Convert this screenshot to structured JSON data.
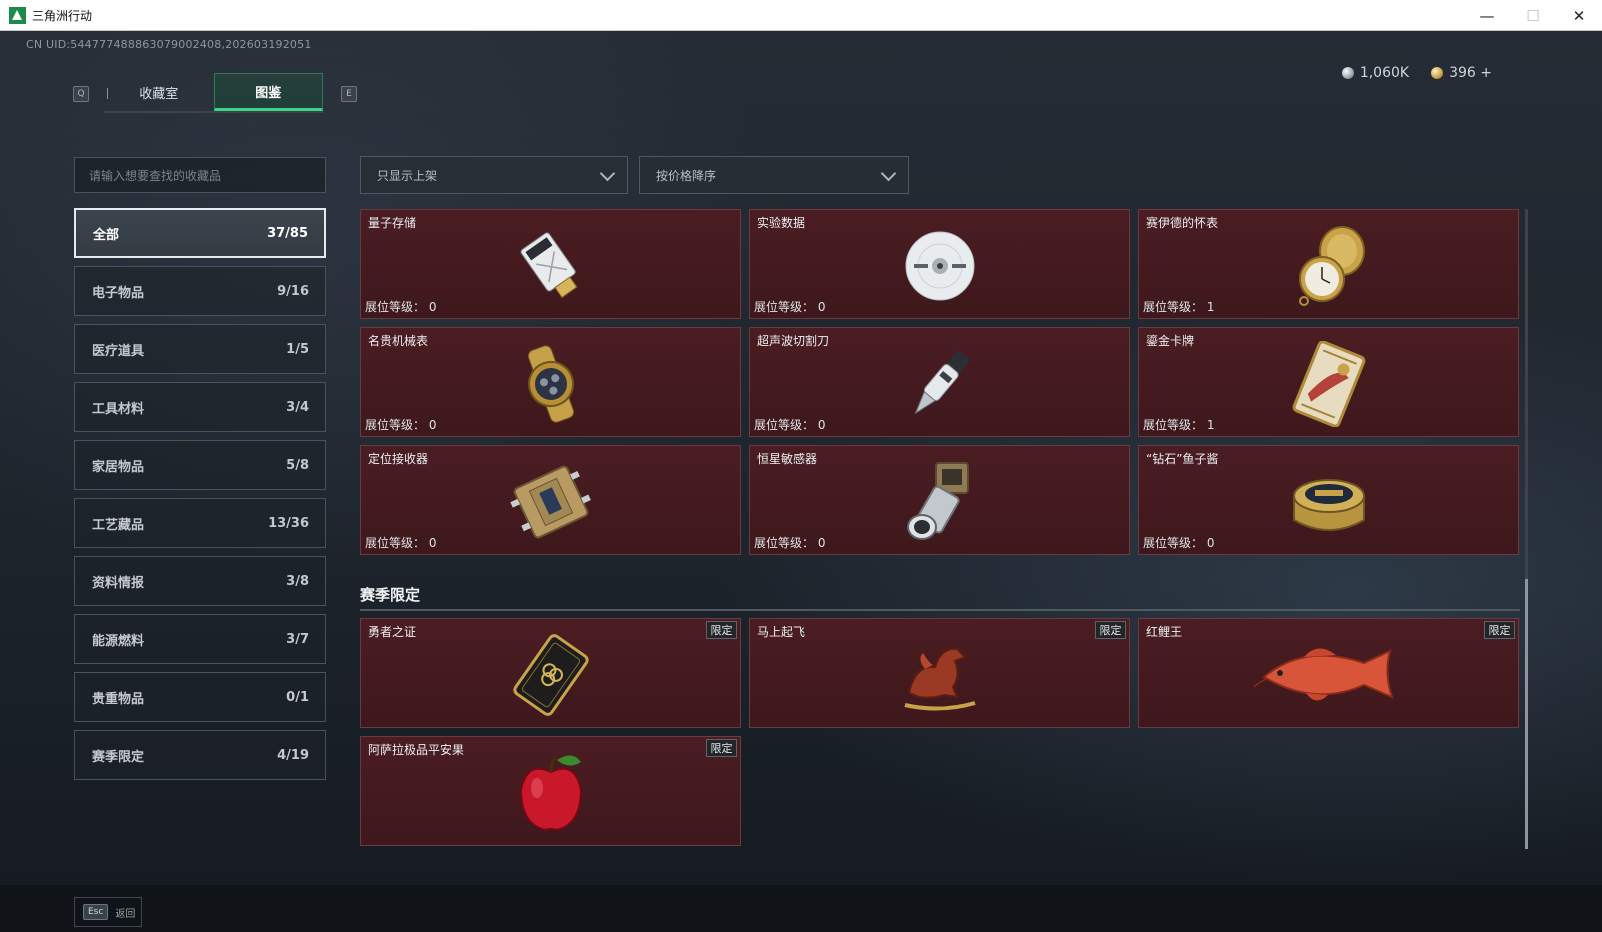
{
  "window": {
    "title": "三角洲行动",
    "controls": [
      "—",
      "☐",
      "✕"
    ]
  },
  "uid": "CN UID:544777488863079002408,202603192051",
  "tabs": {
    "left_key": "Q",
    "right_key": "E",
    "items": [
      "收藏室",
      "图鉴"
    ],
    "active": 1
  },
  "currency": {
    "silver": "1,060K",
    "gold": "396 +"
  },
  "search": {
    "placeholder": "请输入想要查找的收藏品"
  },
  "categories": [
    {
      "label": "全部",
      "count": "37/85",
      "active": true
    },
    {
      "label": "电子物品",
      "count": "9/16"
    },
    {
      "label": "医疗道具",
      "count": "1/5"
    },
    {
      "label": "工具材料",
      "count": "3/4"
    },
    {
      "label": "家居物品",
      "count": "5/8"
    },
    {
      "label": "工艺藏品",
      "count": "13/36"
    },
    {
      "label": "资料情报",
      "count": "3/8"
    },
    {
      "label": "能源燃料",
      "count": "3/7"
    },
    {
      "label": "贵重物品",
      "count": "0/1"
    },
    {
      "label": "赛季限定",
      "count": "4/19"
    }
  ],
  "filters": {
    "display": "只显示上架",
    "sort": "按价格降序"
  },
  "items": [
    {
      "name": "量子存储",
      "level": "展位等级： 0",
      "icon": "usb-drive-icon"
    },
    {
      "name": "实验数据",
      "level": "展位等级： 0",
      "icon": "disc-icon"
    },
    {
      "name": "赛伊德的怀表",
      "level": "展位等级： 1",
      "icon": "pocket-watch-icon"
    },
    {
      "name": "名贵机械表",
      "level": "展位等级： 0",
      "icon": "wristwatch-icon"
    },
    {
      "name": "超声波切割刀",
      "level": "展位等级： 0",
      "icon": "cutter-icon"
    },
    {
      "name": "鎏金卡牌",
      "level": "展位等级： 1",
      "icon": "gold-card-icon"
    },
    {
      "name": "定位接收器",
      "level": "展位等级： 0",
      "icon": "receiver-icon"
    },
    {
      "name": "恒星敏感器",
      "level": "展位等级： 0",
      "icon": "star-sensor-icon"
    },
    {
      "name": "“钻石”鱼子酱",
      "level": "展位等级： 0",
      "icon": "caviar-tin-icon"
    }
  ],
  "season": {
    "title": "赛季限定",
    "tag": "限定",
    "items": [
      {
        "name": "勇者之证",
        "icon": "badge-card-icon"
      },
      {
        "name": "马上起飞",
        "icon": "horse-statue-icon"
      },
      {
        "name": "红鲤王",
        "icon": "carp-icon"
      },
      {
        "name": "阿萨拉极品平安果",
        "icon": "apple-icon"
      }
    ]
  },
  "footer": {
    "key": "Esc",
    "label": "返回"
  }
}
